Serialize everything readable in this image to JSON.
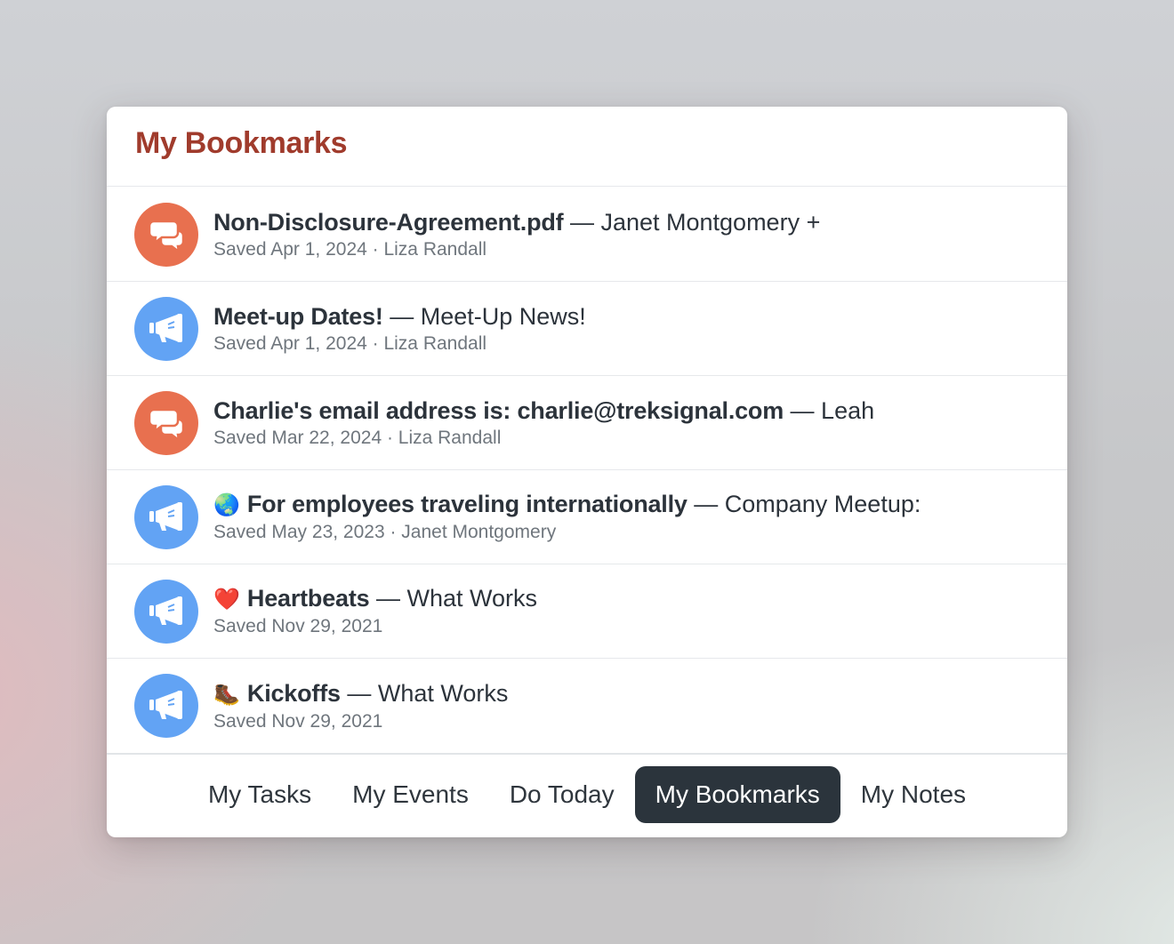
{
  "header": {
    "title": "My Bookmarks"
  },
  "colors": {
    "title": "#a03b2c",
    "message_icon_bg": "#e8704f",
    "announcement_icon_bg": "#62a3f4",
    "active_tab_bg": "#2b343c"
  },
  "bookmarks": [
    {
      "icon": "chat-bubbles-icon",
      "emoji": "",
      "title": "Non-Disclosure-Agreement.pdf",
      "context": " — Janet Montgomery +",
      "meta": "Saved Apr 1, 2024 · Liza Randall"
    },
    {
      "icon": "megaphone-icon",
      "emoji": "",
      "title": "Meet-up Dates!",
      "context": " — Meet-Up News!",
      "meta": "Saved Apr 1, 2024 · Liza Randall"
    },
    {
      "icon": "chat-bubbles-icon",
      "emoji": "",
      "title": "Charlie's email address is: charlie@treksignal.com",
      "context": " — Leah",
      "meta": "Saved Mar 22, 2024 · Liza Randall"
    },
    {
      "icon": "megaphone-icon",
      "emoji": "🌏",
      "title": "For employees traveling internationally",
      "context": " — Company Meetup:",
      "meta": "Saved May 23, 2023 · Janet Montgomery"
    },
    {
      "icon": "megaphone-icon",
      "emoji": "❤️",
      "title": "Heartbeats",
      "context": " — What Works",
      "meta": "Saved Nov 29, 2021"
    },
    {
      "icon": "megaphone-icon",
      "emoji": "🥾",
      "title": "Kickoffs",
      "context": " — What Works",
      "meta": "Saved Nov 29, 2021"
    }
  ],
  "tabs": [
    {
      "label": "My Tasks",
      "active": false
    },
    {
      "label": "My Events",
      "active": false
    },
    {
      "label": "Do Today",
      "active": false
    },
    {
      "label": "My Bookmarks",
      "active": true
    },
    {
      "label": "My Notes",
      "active": false
    }
  ]
}
